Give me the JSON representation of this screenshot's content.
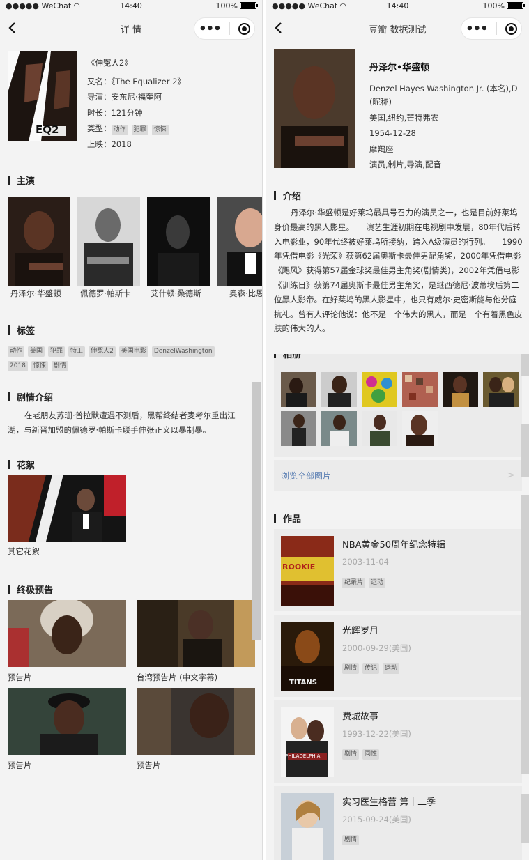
{
  "status": {
    "carrier": "●●●●● WeChat",
    "time": "14:40",
    "battery": "100%"
  },
  "left": {
    "nav_title": "详 情",
    "movie": {
      "title": "《伸冤人2》",
      "alias": "又名：《The Equalizer 2》",
      "director": "导演：安东尼·福奎阿",
      "duration": "时长：121分钟",
      "genre_label": "类型：",
      "genres": [
        "动作",
        "犯罪",
        "惊悚"
      ],
      "release": "上映：2018",
      "poster_text": "EQ2"
    },
    "cast_heading": "主演",
    "cast": [
      "丹泽尔·华盛顿",
      "佩德罗·帕斯卡",
      "艾什顿·桑德斯",
      "奥森·比恩"
    ],
    "tags_heading": "标签",
    "tags": [
      "动作",
      "美国",
      "犯罪",
      "特工",
      "伸冤人2",
      "美国电影",
      "DenzelWashington",
      "2018",
      "惊悚",
      "剧情"
    ],
    "plot_heading": "剧情介绍",
    "plot": "在老朋友苏珊·普拉默遭遇不测后，黑帮终结者麦考尔重出江湖，与新晋加盟的佩德罗·帕斯卡联手伸张正义以暴制暴。",
    "clips_heading": "花絮",
    "clip_caption": "其它花絮",
    "trailer_heading": "终极预告",
    "trailers": [
      "预告片",
      "台湾预告片 (中文字幕)",
      "预告片",
      "预告片"
    ]
  },
  "right": {
    "nav_title": "豆瓣 数据测试",
    "person": {
      "name": "丹泽尔•华盛顿",
      "full_name": "Denzel Hayes Washington Jr. (本名),D (昵称)",
      "birthplace": "美国,纽约,芒特弗农",
      "birthday": "1954-12-28",
      "zodiac": "摩羯座",
      "roles": "演员,制片,导演,配音"
    },
    "intro_heading": "介绍",
    "intro": "丹泽尔·华盛顿是好莱坞最具号召力的演员之一，也是目前好莱坞身价最高的黑人影星。　　演艺生涯初期在电视剧中发展，80年代后转入电影业，90年代终被好莱坞所接纳，跨入A级演员的行列。　　1990年凭借电影《光荣》获第62届奥斯卡最佳男配角奖，2000年凭借电影《飓风》获得第57届金球奖最佳男主角奖(剧情类)，2002年凭借电影《训练日》获第74届奥斯卡最佳男主角奖，是继西德尼·波蒂埃后第二位黑人影帝。在好莱坞的黑人影星中，也只有威尔·史密斯能与他分庭抗礼。曾有人评论他说：他不是一个伟大的黑人，而是一个有着黑色皮肤的伟大的人。",
    "photos_heading": "相册",
    "browse_all": "浏览全部图片",
    "works_heading": "作品",
    "works": [
      {
        "title": "NBA黄金50周年纪念特辑",
        "date": "2003-11-04",
        "tags": [
          "纪录片",
          "运动"
        ]
      },
      {
        "title": "光辉岁月",
        "date": "2000-09-29(美国)",
        "tags": [
          "剧情",
          "传记",
          "运动"
        ]
      },
      {
        "title": "费城故事",
        "date": "1993-12-22(美国)",
        "tags": [
          "剧情",
          "同性"
        ]
      },
      {
        "title": "实习医生格蕾 第十二季",
        "date": "2015-09-24(美国)",
        "tags": [
          "剧情"
        ]
      }
    ],
    "poster_texts": [
      "ROOKIE",
      "TITANS",
      "PHILADELPHIA",
      ""
    ]
  }
}
